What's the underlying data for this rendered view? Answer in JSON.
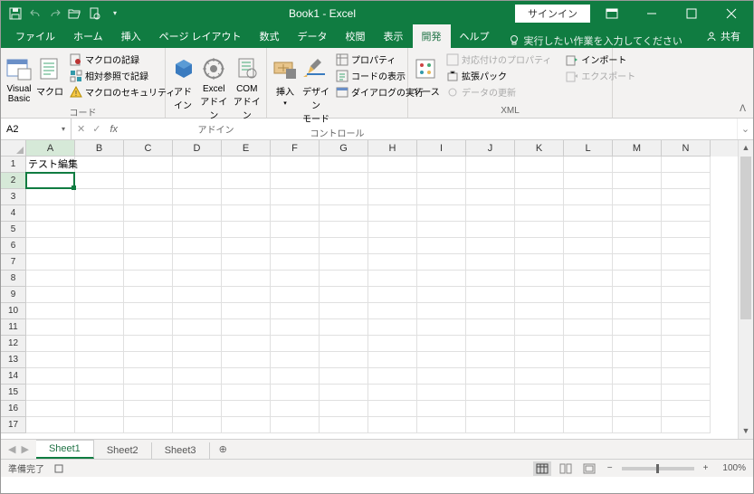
{
  "title": "Book1  -  Excel",
  "signin": "サインイン",
  "tabs": [
    "ファイル",
    "ホーム",
    "挿入",
    "ページ レイアウト",
    "数式",
    "データ",
    "校閲",
    "表示",
    "開発",
    "ヘルプ"
  ],
  "active_tab": "開発",
  "tellme_placeholder": "実行したい作業を入力してください",
  "share": "共有",
  "ribbon": {
    "code": {
      "label": "コード",
      "vb": "Visual Basic",
      "macro": "マクロ",
      "rec": "マクロの記録",
      "rel": "相対参照で記録",
      "sec": "マクロのセキュリティ"
    },
    "addin": {
      "label": "アドイン",
      "addin": "アド\nイン",
      "excel": "Excel\nアドイン",
      "com": "COM\nアドイン"
    },
    "ctrl": {
      "label": "コントロール",
      "insert": "挿入",
      "design": "デザイン\nモード",
      "prop": "プロパティ",
      "view": "コードの表示",
      "dlg": "ダイアログの実行"
    },
    "xml": {
      "label": "XML",
      "source": "ソース",
      "mapprop": "対応付けのプロパティ",
      "expand": "拡張パック",
      "refresh": "データの更新",
      "import": "インポート",
      "export": "エクスポート"
    }
  },
  "namebox": "A2",
  "columns": [
    "A",
    "B",
    "C",
    "D",
    "E",
    "F",
    "G",
    "H",
    "I",
    "J",
    "K",
    "L",
    "M",
    "N"
  ],
  "sel_col": "A",
  "rows": 17,
  "sel_row": 2,
  "cells": {
    "A1": "テスト編集"
  },
  "sheets": [
    "Sheet1",
    "Sheet2",
    "Sheet3"
  ],
  "active_sheet": "Sheet1",
  "status": "準備完了",
  "zoom": "100%"
}
